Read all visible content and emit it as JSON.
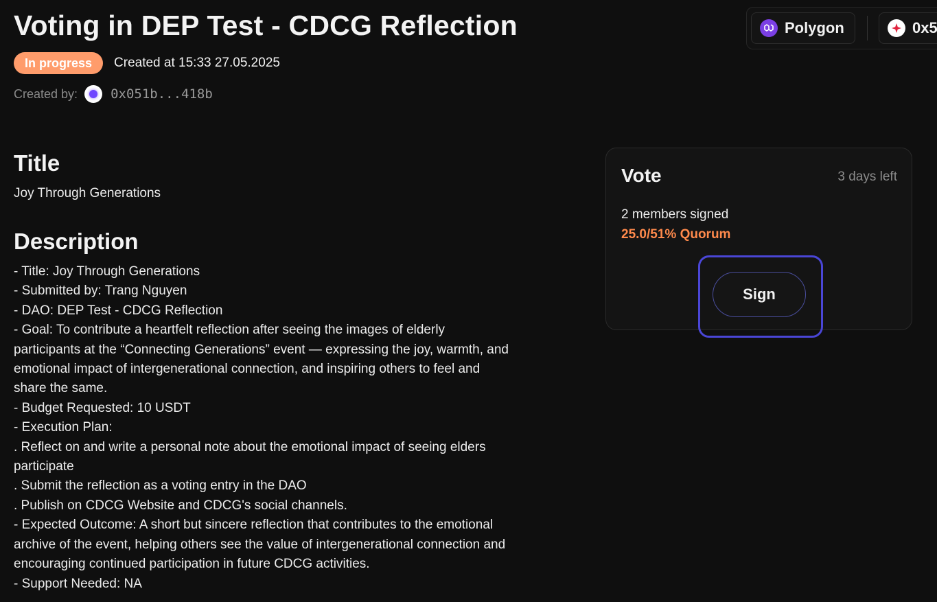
{
  "header": {
    "title": "Voting in DEP Test - CDCG Reflection",
    "status": "In progress",
    "created_at": "Created at 15:33 27.05.2025",
    "created_by_label": "Created by:",
    "creator_address": "0x051b...418b"
  },
  "network": {
    "chain_label": "Polygon",
    "wallet_label": "0x5",
    "chain_icon": "polygon-icon",
    "wallet_icon": "wallet-icon"
  },
  "proposal": {
    "title_heading": "Title",
    "title_value": "Joy Through Generations",
    "description_heading": "Description",
    "description_lines": [
      "- Title: Joy Through Generations",
      "- Submitted by: Trang Nguyen",
      "- DAO: DEP Test - CDCG Reflection",
      "- Goal: To contribute a heartfelt reflection after seeing the images of elderly",
      "participants at the “Connecting Generations” event — expressing the joy, warmth, and",
      "emotional impact of intergenerational connection, and inspiring others to feel and",
      "share the same.",
      "- Budget Requested: 10 USDT",
      "- Execution Plan:",
      ". Reflect on and write a personal note about the emotional impact of seeing elders",
      "participate",
      ". Submit the reflection as a voting entry in the DAO",
      ". Publish on CDCG Website and CDCG's social channels.",
      "- Expected Outcome: A short but sincere reflection that contributes to the emotional",
      "archive of the event, helping others see the value of intergenerational connection and",
      "encouraging continued participation in future CDCG activities.",
      "- Support Needed: NA"
    ]
  },
  "vote": {
    "heading": "Vote",
    "time_left": "3 days left",
    "members_signed": "2 members signed",
    "quorum": "25.0/51% Quorum",
    "sign_label": "Sign"
  },
  "colors": {
    "background": "#0f0f0f",
    "status_badge": "#ff9c6b",
    "quorum": "#ff8a4c",
    "focus_ring": "#4a46d6",
    "polygon": "#7b3fe4"
  }
}
